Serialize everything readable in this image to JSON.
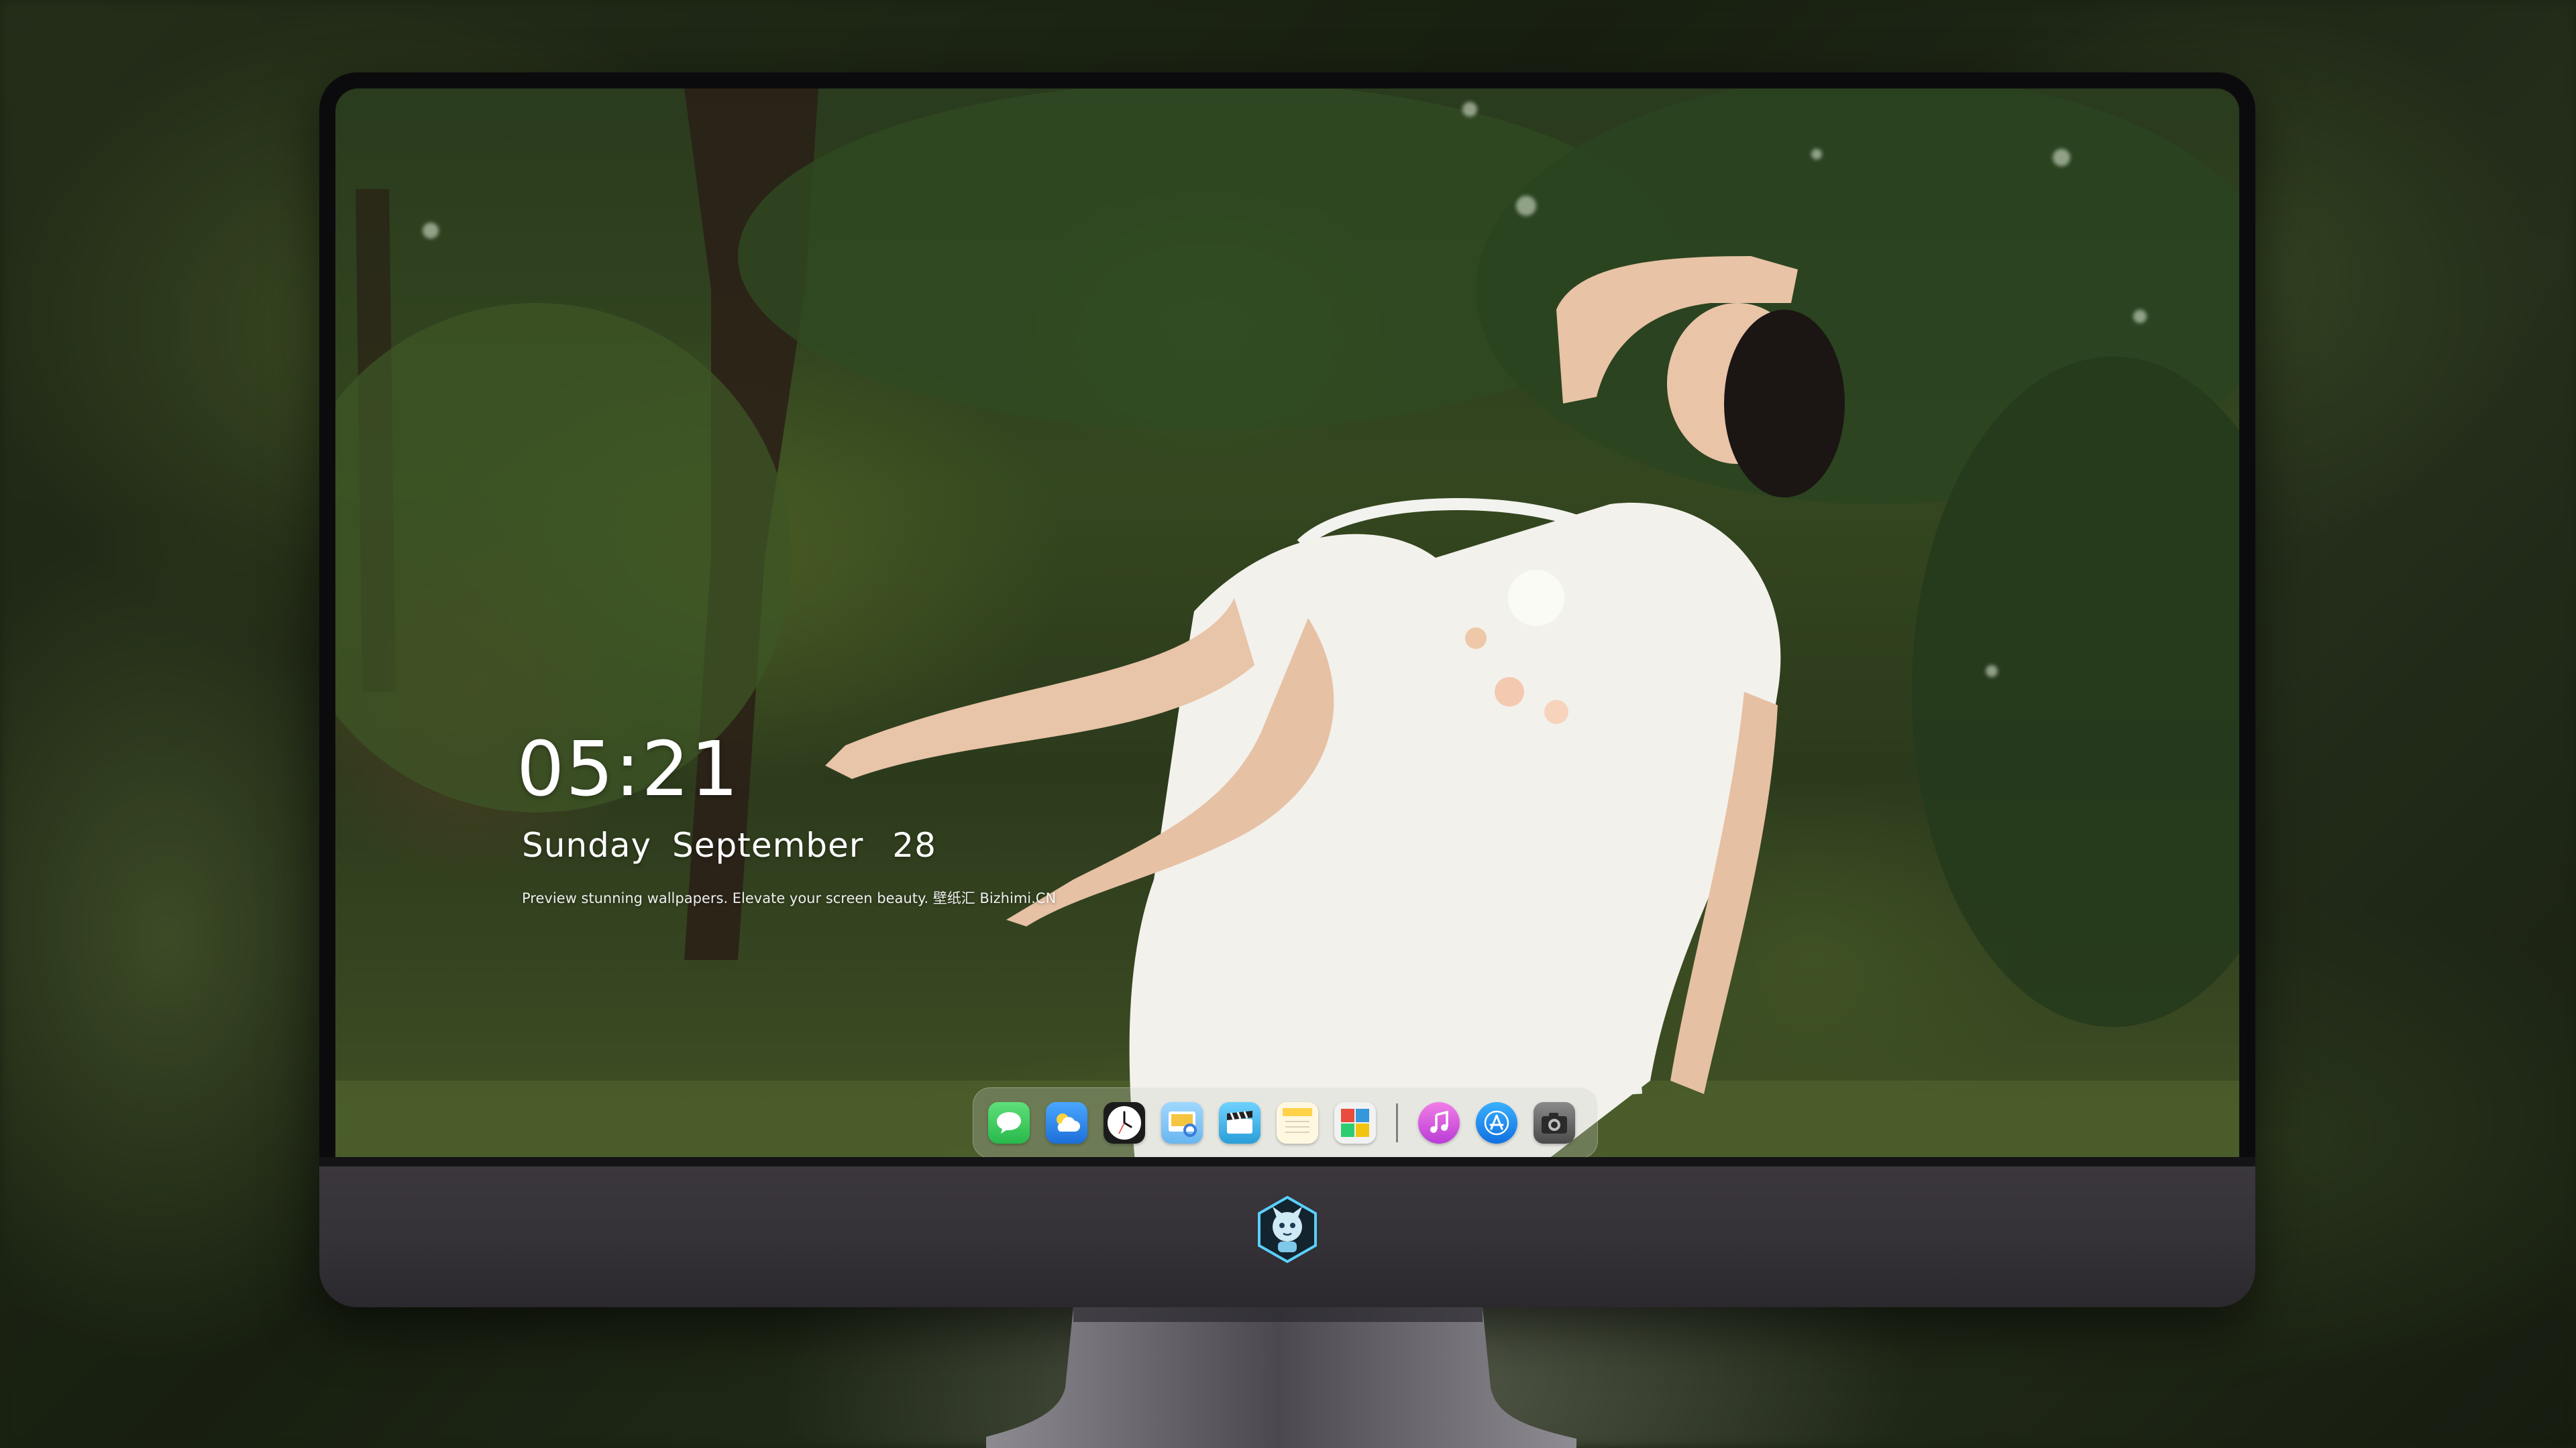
{
  "lock_screen": {
    "time": "05:21",
    "weekday": "Sunday",
    "month": "September",
    "day": "28",
    "tagline": "Preview stunning wallpapers. Elevate your screen beauty. 壁纸汇 Bizhimi.CN"
  },
  "dock": {
    "apps": [
      {
        "name": "Messages",
        "icon": "messages-icon",
        "color": "#34c759"
      },
      {
        "name": "Weather",
        "icon": "weather-icon",
        "color": "#2b8ef0"
      },
      {
        "name": "Clock",
        "icon": "clock-icon",
        "color": "#ffffff"
      },
      {
        "name": "Preview",
        "icon": "preview-icon",
        "color": "#f5c542"
      },
      {
        "name": "Clips",
        "icon": "clips-icon",
        "color": "#3fb6e8"
      },
      {
        "name": "Notes",
        "icon": "notes-icon",
        "color": "#ffd85a"
      },
      {
        "name": "Photo Booth",
        "icon": "photo-booth-icon",
        "color": "#e74c3c"
      },
      {
        "name": "iTunes",
        "icon": "itunes-icon",
        "color": "#d94bd0"
      },
      {
        "name": "App Store",
        "icon": "app-store-icon",
        "color": "#1c8cf2"
      },
      {
        "name": "Screenshot",
        "icon": "camera-icon",
        "color": "#555555"
      }
    ]
  },
  "monitor": {
    "logo": "mascot-logo-icon",
    "bezel_color": "#0b0b0d",
    "chin_color": "#363339"
  }
}
